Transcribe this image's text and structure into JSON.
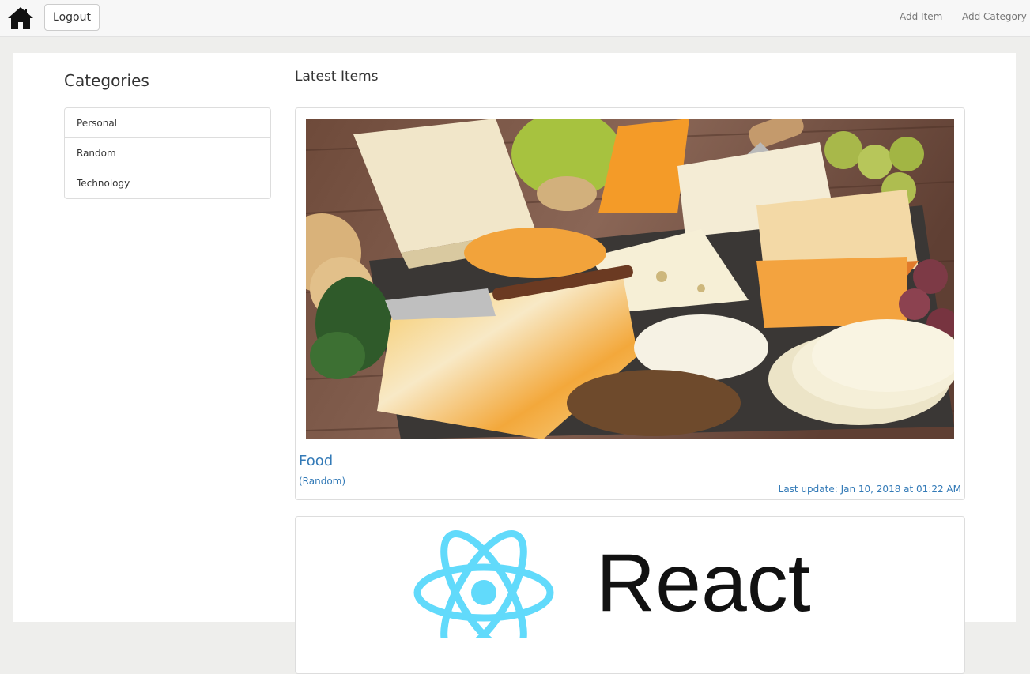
{
  "navbar": {
    "logout_label": "Logout",
    "links": {
      "add_item": "Add Item",
      "add_category": "Add Category"
    },
    "home_icon": "home-icon"
  },
  "sidebar": {
    "title": "Categories",
    "categories": [
      {
        "label": "Personal"
      },
      {
        "label": "Random"
      },
      {
        "label": "Technology"
      }
    ]
  },
  "main": {
    "title": "Latest Items",
    "items": [
      {
        "title": "Food",
        "category": "(Random)",
        "last_update": "Last update: Jan 10, 2018 at 01:22 AM",
        "image": "cheese-platter-photo"
      },
      {
        "image": "react-logo",
        "wordmark": "React"
      }
    ]
  },
  "colors": {
    "link": "#337ab7",
    "navbar_bg": "#f7f7f7",
    "page_bg": "#eeeeec",
    "react_accent": "#61dafb"
  }
}
